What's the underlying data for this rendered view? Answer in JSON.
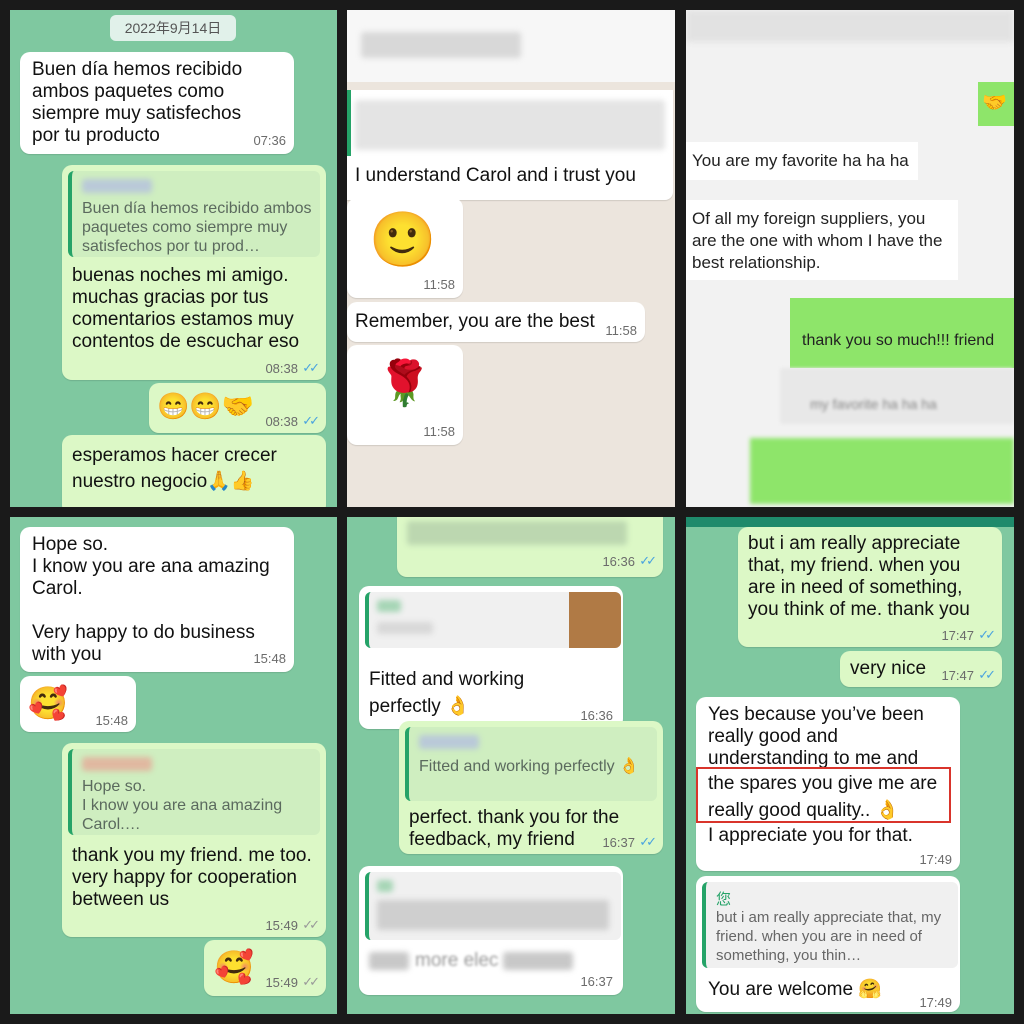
{
  "panel1": {
    "date": "2022年9月14日",
    "msg1": {
      "text": "Buen día hemos recibido ambos paquetes como siempre muy satisfechos por tu producto",
      "time": "07:36"
    },
    "msg2": {
      "quote": "Buen día hemos recibido ambos paquetes como siempre muy satisfechos por tu prod…",
      "text": "buenas noches mi amigo. muchas gracias por tus comentarios estamos muy contentos de escuchar eso",
      "time": "08:38"
    },
    "msg3": {
      "emoji": "😁😁🤝",
      "time": "08:38"
    },
    "msg4": {
      "text": "esperamos hacer crecer nuestro negocio🙏👍"
    }
  },
  "panel2": {
    "msg1": {
      "text": "I understand Carol and i trust you"
    },
    "msg2": {
      "emoji": "🙂",
      "time": "11:58"
    },
    "msg3": {
      "text": "Remember, you are the best",
      "time": "11:58"
    },
    "msg4": {
      "emoji": "🌹",
      "time": "11:58"
    }
  },
  "panel3": {
    "msg1": {
      "emoji": "🤝"
    },
    "msg2": {
      "text": "You are my favorite ha ha ha"
    },
    "msg3": {
      "text": "Of all my foreign suppliers, you are the one with whom I have the best relationship."
    },
    "msg4": {
      "text": "thank you so much!!! friend"
    },
    "msg5": {
      "quote": "my favorite ha ha ha"
    }
  },
  "panel4": {
    "msg1": {
      "text": "Hope so.\nI know you are ana amazing Carol.\n\nVery happy to do business with you",
      "time": "15:48"
    },
    "msg2": {
      "emoji": "🥰",
      "time": "15:48"
    },
    "msg3": {
      "quote": "Hope so.\nI know you are ana amazing Carol.…",
      "text": "thank you  my friend. me too. very happy for cooperation between us",
      "time": "15:49"
    },
    "msg4": {
      "emoji": "🥰",
      "time": "15:49"
    }
  },
  "panel5": {
    "msg0": {
      "time": "16:36"
    },
    "msg1": {
      "text": "Fitted and working perfectly 👌",
      "time": "16:36"
    },
    "msg2": {
      "quote": "Fitted and working perfectly 👌",
      "text": "perfect. thank you for the feedback, my friend",
      "time": "16:37"
    },
    "msg3": {
      "text": "more elec",
      "time": "16:37"
    }
  },
  "panel6": {
    "msg1": {
      "text": "but i am really appreciate that, my friend. when you are in need of something, you think of me. thank you",
      "time": "17:47"
    },
    "msg2": {
      "text": "very nice",
      "time": "17:47"
    },
    "msg3": {
      "line1": "Yes because you’ve been really good and understanding to me and",
      "line2": "the spares you give me are really good quality.. 👌",
      "line3": "I appreciate you for that.",
      "time": "17:49"
    },
    "msg4": {
      "sender": "您",
      "quote": "but i am really appreciate that, my friend. when you are in need of something, you thin…",
      "text": "You are welcome 🤗",
      "time": "17:49"
    }
  },
  "ticks": "✓✓",
  "colors": {
    "chat_bg": "#7fc8a0",
    "outgoing": "#dcf8c6",
    "incoming": "#ffffff",
    "tick": "#4aa3df",
    "highlight": "#d9342b"
  }
}
